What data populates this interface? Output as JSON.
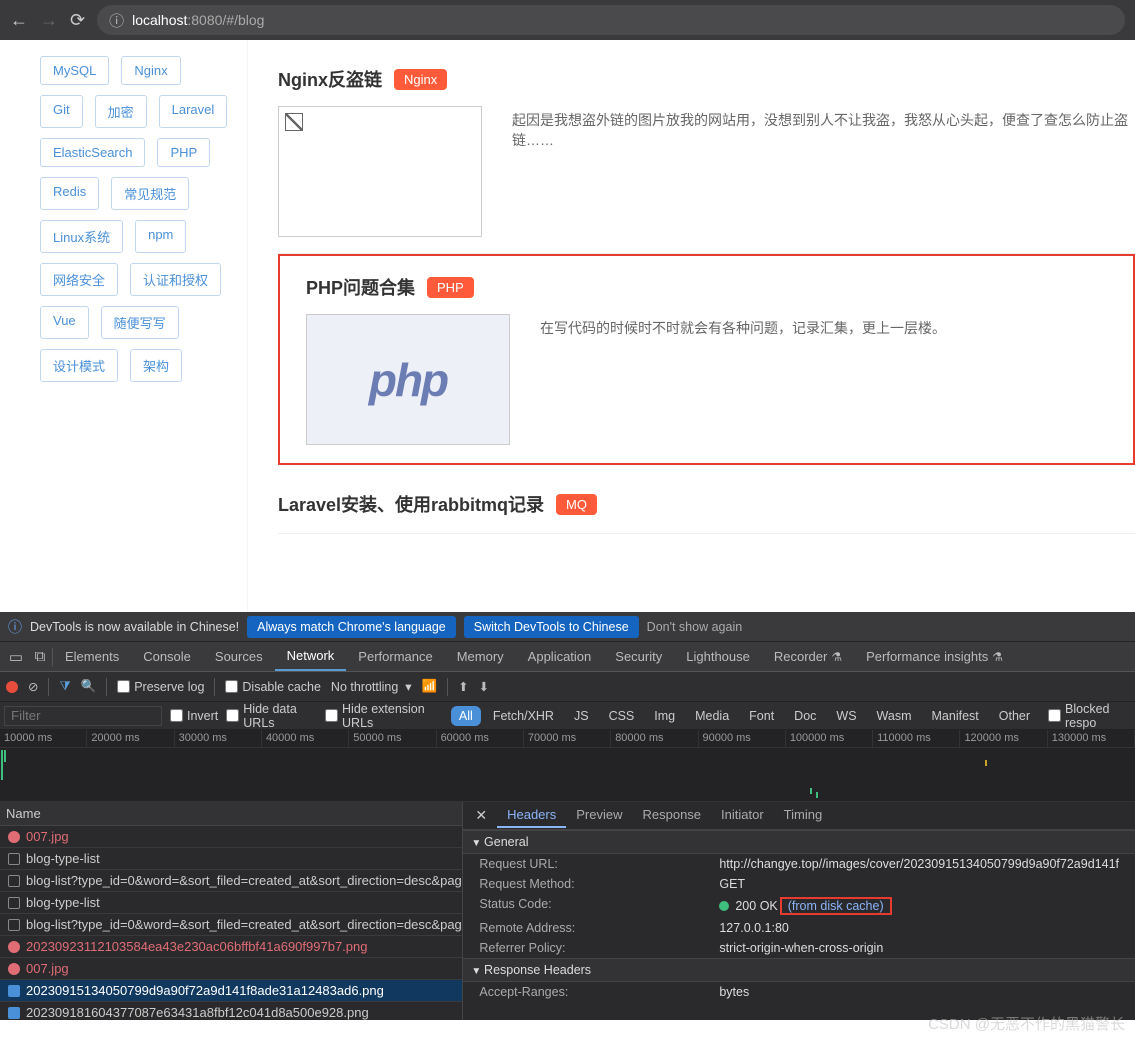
{
  "browser": {
    "url_host": "localhost",
    "url_path": ":8080/#/blog"
  },
  "sidebar_tags": [
    "MySQL",
    "Nginx",
    "Git",
    "加密",
    "Laravel",
    "ElasticSearch",
    "PHP",
    "Redis",
    "常见规范",
    "Linux系统",
    "npm",
    "网络安全",
    "认证和授权",
    "Vue",
    "随便写写",
    "设计模式",
    "架构"
  ],
  "articles": [
    {
      "title": "Nginx反盗链",
      "tag": "Nginx",
      "desc": "起因是我想盗外链的图片放我的网站用，没想到别人不让我盗，我怒从心头起，便查了查怎么防止盗链……",
      "thumb": "broken"
    },
    {
      "title": "PHP问题合集",
      "tag": "PHP",
      "desc": "在写代码的时候时不时就会有各种问题，记录汇集，更上一层楼。",
      "thumb": "php",
      "boxed": true
    },
    {
      "title": "Laravel安装、使用rabbitmq记录",
      "tag": "MQ",
      "desc": "",
      "thumb": "none"
    }
  ],
  "devtools": {
    "banner": {
      "msg": "DevTools is now available in Chinese!",
      "btn1": "Always match Chrome's language",
      "btn2": "Switch DevTools to Chinese",
      "btn3": "Don't show again"
    },
    "tabs": [
      "Elements",
      "Console",
      "Sources",
      "Network",
      "Performance",
      "Memory",
      "Application",
      "Security",
      "Lighthouse",
      "Recorder",
      "Performance insights"
    ],
    "active_tab": "Network",
    "toolbar": {
      "preserve": "Preserve log",
      "disable": "Disable cache",
      "throttle": "No throttling"
    },
    "filter": {
      "placeholder": "Filter",
      "invert": "Invert",
      "hide_data": "Hide data URLs",
      "hide_ext": "Hide extension URLs",
      "blocked": "Blocked respo",
      "types": [
        "All",
        "Fetch/XHR",
        "JS",
        "CSS",
        "Img",
        "Media",
        "Font",
        "Doc",
        "WS",
        "Wasm",
        "Manifest",
        "Other"
      ]
    },
    "timeline": [
      "10000 ms",
      "20000 ms",
      "30000 ms",
      "40000 ms",
      "50000 ms",
      "60000 ms",
      "70000 ms",
      "80000 ms",
      "90000 ms",
      "100000 ms",
      "110000 ms",
      "120000 ms",
      "130000 ms"
    ],
    "req_header": "Name",
    "requests": [
      {
        "name": "007.jpg",
        "status": "err"
      },
      {
        "name": "blog-type-list",
        "status": "ok"
      },
      {
        "name": "blog-list?type_id=0&word=&sort_filed=created_at&sort_direction=desc&pag...",
        "status": "ok"
      },
      {
        "name": "blog-type-list",
        "status": "ok"
      },
      {
        "name": "blog-list?type_id=0&word=&sort_filed=created_at&sort_direction=desc&pag...",
        "status": "ok"
      },
      {
        "name": "20230923112103584ea43e230ac06bffbf41a690f997b7.png",
        "status": "err"
      },
      {
        "name": "007.jpg",
        "status": "err"
      },
      {
        "name": "20230915134050799d9a90f72a9d141f8ade31a12483ad6.png",
        "status": "img",
        "selected": true
      },
      {
        "name": "202309181604377087e63431a8fbf12c041d8a500e928.png",
        "status": "img"
      }
    ],
    "detail_tabs": [
      "Headers",
      "Preview",
      "Response",
      "Initiator",
      "Timing"
    ],
    "detail_active": "Headers",
    "sections": {
      "general": "General",
      "response": "Response Headers"
    },
    "headers": {
      "request_url_k": "Request URL:",
      "request_url_v": "http://changye.top//images/cover/20230915134050799d9a90f72a9d141f",
      "method_k": "Request Method:",
      "method_v": "GET",
      "status_k": "Status Code:",
      "status_v": "200 OK",
      "cache": "(from disk cache)",
      "remote_k": "Remote Address:",
      "remote_v": "127.0.0.1:80",
      "referrer_k": "Referrer Policy:",
      "referrer_v": "strict-origin-when-cross-origin",
      "accept_k": "Accept-Ranges:",
      "accept_v": "bytes"
    }
  },
  "watermark": "CSDN @无恶不作的黑猫警长"
}
